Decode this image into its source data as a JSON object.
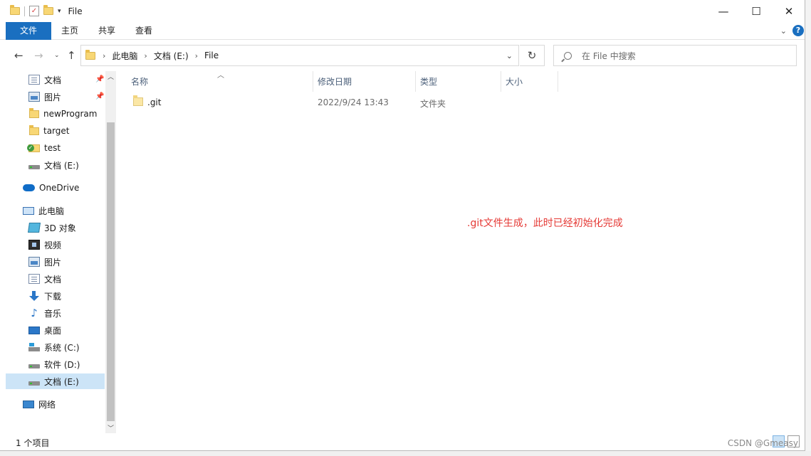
{
  "window": {
    "title": "File",
    "controls": {
      "minimize": "—",
      "maximize": "☐",
      "close": "✕"
    }
  },
  "ribbon": {
    "tabs": [
      "文件",
      "主页",
      "共享",
      "查看"
    ],
    "help": "?"
  },
  "address": {
    "breadcrumb": [
      "此电脑",
      "文档 (E:)",
      "File"
    ]
  },
  "search": {
    "placeholder": "在 File 中搜索"
  },
  "nav": {
    "quick_access": [
      {
        "label": "文档",
        "icon": "document-icon",
        "pinned": true
      },
      {
        "label": "图片",
        "icon": "picture-icon",
        "pinned": true
      },
      {
        "label": "newProgram",
        "icon": "folder-icon",
        "pinned": false
      },
      {
        "label": "target",
        "icon": "folder-icon",
        "pinned": false
      },
      {
        "label": "test",
        "icon": "synced-folder-icon",
        "pinned": false
      },
      {
        "label": "文档 (E:)",
        "icon": "drive-icon",
        "pinned": false
      }
    ],
    "onedrive": "OneDrive",
    "this_pc": "此电脑",
    "pc_items": [
      {
        "label": "3D 对象",
        "icon": "3d-objects-icon"
      },
      {
        "label": "视频",
        "icon": "video-icon"
      },
      {
        "label": "图片",
        "icon": "picture-icon"
      },
      {
        "label": "文档",
        "icon": "document-icon"
      },
      {
        "label": "下载",
        "icon": "download-icon"
      },
      {
        "label": "音乐",
        "icon": "music-icon"
      },
      {
        "label": "桌面",
        "icon": "desktop-icon"
      },
      {
        "label": "系统 (C:)",
        "icon": "system-drive-icon"
      },
      {
        "label": "软件 (D:)",
        "icon": "drive-icon"
      },
      {
        "label": "文档 (E:)",
        "icon": "drive-icon",
        "selected": true
      }
    ],
    "network": "网络"
  },
  "columns": [
    "名称",
    "修改日期",
    "类型",
    "大小"
  ],
  "files": [
    {
      "name": ".git",
      "modified": "2022/9/24 13:43",
      "type": "文件夹",
      "size": ""
    }
  ],
  "annotation": ".git文件生成，此时已经初始化完成",
  "status": {
    "count": "1 个项目"
  },
  "watermark": "CSDN @Gmeasy",
  "colors": {
    "accent": "#1a6fc0",
    "selection": "#cce4f7",
    "annotation": "#e53935"
  }
}
